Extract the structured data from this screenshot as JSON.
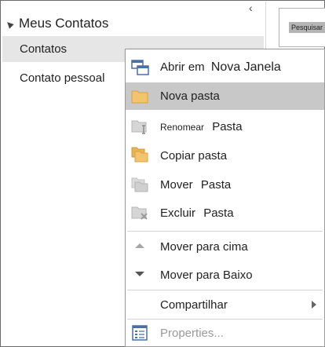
{
  "sidebar": {
    "header": "Meus Contatos",
    "items": [
      {
        "label": "Contatos",
        "selected": true
      },
      {
        "label": "Contato pessoal",
        "selected": false
      }
    ]
  },
  "search": {
    "label": "Pesquisar"
  },
  "context_menu": {
    "items": [
      {
        "icon": "new-window-icon",
        "label_a": "Abrir em",
        "label_b": "Nova Janela"
      },
      {
        "icon": "new-folder-icon",
        "label": "Nova pasta",
        "highlighted": true
      },
      {
        "icon": "rename-folder-icon",
        "label_a": "Renomear",
        "label_b": "Pasta",
        "disabled": true
      },
      {
        "icon": "copy-folder-icon",
        "label": "Copiar pasta"
      },
      {
        "icon": "move-folder-icon",
        "label_a": "Mover",
        "label_b": "Pasta",
        "disabled": true
      },
      {
        "icon": "delete-folder-icon",
        "label_a": "Excluir",
        "label_b": "Pasta",
        "disabled": true
      },
      {
        "icon": "move-up-icon",
        "label": "Mover para cima",
        "disabled": true
      },
      {
        "icon": "move-down-icon",
        "label": "Mover para Baixo"
      },
      {
        "icon": "none",
        "label": "Compartilhar",
        "submenu": true
      },
      {
        "icon": "properties-icon",
        "label": "Properties...",
        "disabled": true
      }
    ]
  },
  "colors": {
    "highlight": "#c8c8c8",
    "folder": "#f2c46d",
    "selected": "#e6e6e6"
  }
}
